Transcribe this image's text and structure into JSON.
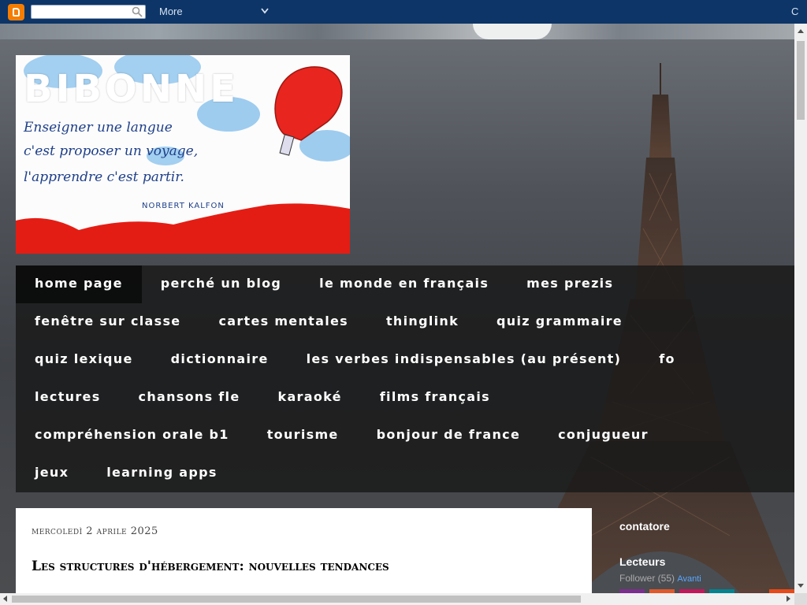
{
  "navbar": {
    "search_placeholder": "",
    "more_label": "More",
    "right_label": "C"
  },
  "header": {
    "blog_title": "BIBONNE",
    "image_quote_lines": [
      "Enseigner une langue",
      "c'est proposer un voyage,",
      "l'apprendre c'est partir."
    ],
    "image_author": "NORBERT KALFON"
  },
  "tabs": [
    [
      "Home page",
      "Perché un blog",
      "Le monde en français",
      "Mes Prezis"
    ],
    [
      "Fenêtre sur classe",
      "Cartes mentales",
      "Thinglink",
      "Quiz grammaire"
    ],
    [
      "Quiz lexique",
      "Dictionnaire",
      "Les verbes indispensables (au présent)",
      "Fo"
    ],
    [
      "Lectures",
      "Chansons FLE",
      "Karaoké",
      "Films français"
    ],
    [
      "Compréhension orale B1",
      "Tourisme",
      "Bonjour de France",
      "Conjugueur"
    ],
    [
      "Jeux",
      "Learning apps"
    ]
  ],
  "post": {
    "date": "mercoledì 2 aprile 2025",
    "title": "Les structures d'hébergement: nouvelles tendances"
  },
  "sidebar": {
    "contatore_title": "contatore",
    "lecteurs_title": "Lecteurs",
    "follower_text": "Follower (55)",
    "next_link": "Avanti"
  },
  "colors": {
    "navbar": "#0d3567",
    "blogger_orange": "#f57d00",
    "tab_bar": "#191919",
    "balloon_red": "#e8251f"
  },
  "avatars": [
    "#7b2d8e",
    "#e0592a",
    "#c2185b",
    "#00838f",
    "#5d4037",
    "#e64a19"
  ]
}
